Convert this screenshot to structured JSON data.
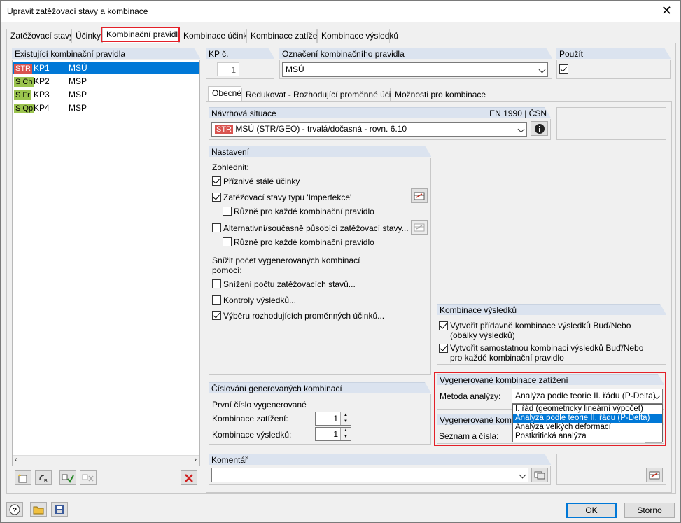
{
  "window": {
    "title": "Upravit zatěžovací stavy a kombinace"
  },
  "tabs": [
    {
      "label": "Zatěžovací stavy"
    },
    {
      "label": "Účinky"
    },
    {
      "label": "Kombinační pravidla"
    },
    {
      "label": "Kombinace účinků"
    },
    {
      "label": "Kombinace zatížení"
    },
    {
      "label": "Kombinace výsledků"
    }
  ],
  "left_panel": {
    "header": "Existující kombinační pravidla",
    "rows": [
      {
        "tag": "STR",
        "id": "KP1",
        "name": "MSÚ"
      },
      {
        "tag": "S Ch",
        "id": "KP2",
        "name": "MSP"
      },
      {
        "tag": "S Fr",
        "id": "KP3",
        "name": "MSP"
      },
      {
        "tag": "S Qp",
        "id": "KP4",
        "name": "MSP"
      }
    ]
  },
  "kp_no": {
    "label": "KP č.",
    "value": "1"
  },
  "rule_name": {
    "label": "Označení kombinačního pravidla",
    "value": "MSÚ"
  },
  "use": {
    "label": "Použít"
  },
  "subtabs": [
    {
      "label": "Obecné"
    },
    {
      "label": "Redukovat - Rozhodující proměnné účinky"
    },
    {
      "label": "Možnosti pro kombinace"
    }
  ],
  "design_situation": {
    "label": "Návrhová situace",
    "norm": "EN 1990 | ČSN",
    "tag": "STR",
    "value": "MSÚ (STR/GEO) - trvalá/dočasná - rovn. 6.10"
  },
  "settings": {
    "header": "Nastavení",
    "consider": "Zohlednit:",
    "favorable": "Příznivé stálé účinky",
    "imperfection": "Zatěžovací stavy typu 'Imperfekce'",
    "different1": "Různě pro každé kombinační pravidlo",
    "alternative": "Alternativní/současně působící zatěžovací stavy...",
    "different2": "Různě pro každé kombinační pravidlo",
    "reduce_line1": "Snížit počet vygenerovaných kombinací",
    "reduce_line2": "pomocí:",
    "reduce_lc": "Snížení počtu zatěžovacích stavů...",
    "result_checks": "Kontroly výsledků...",
    "decisive": "Výběru rozhodujících proměnných účinků..."
  },
  "result_combos": {
    "header": "Kombinace výsledků",
    "opt1_line1": "Vytvořit přídavně kombinace výsledků Buď/Nebo",
    "opt1_line2": "(obálky výsledků)",
    "opt2_line1": "Vytvořit samostatnou kombinaci výsledků Buď/Nebo",
    "opt2_line2": "pro každé kombinační pravidlo"
  },
  "numbering": {
    "header": "Číslování generovaných kombinací",
    "first": "První číslo vygenerované",
    "load_combo": "Kombinace zatížení:",
    "load_combo_value": "1",
    "result_combo": "Kombinace výsledků:",
    "result_combo_value": "1"
  },
  "generated_lc": {
    "header": "Vygenerované kombinace zatížení",
    "method_label": "Metoda analýzy:",
    "method_value": "Analýza podle teorie II. řádu (P-Delta)",
    "options": [
      "I. řád (geometricky lineární výpočet)",
      "Analýza podle teorie II. řádu (P-Delta)",
      "Analýza velkých deformací",
      "Postkritická analýza"
    ],
    "generated_header": "Vygenerované kombin",
    "list_label": "Seznam a čísla:"
  },
  "comment": {
    "label": "Komentář",
    "value": ""
  },
  "buttons": {
    "ok": "OK",
    "cancel": "Storno"
  },
  "colors": {
    "accent": "#0078d7",
    "highlight": "#e32028",
    "str_tag": "#d9534f",
    "s_tag": "#9bc44e"
  }
}
